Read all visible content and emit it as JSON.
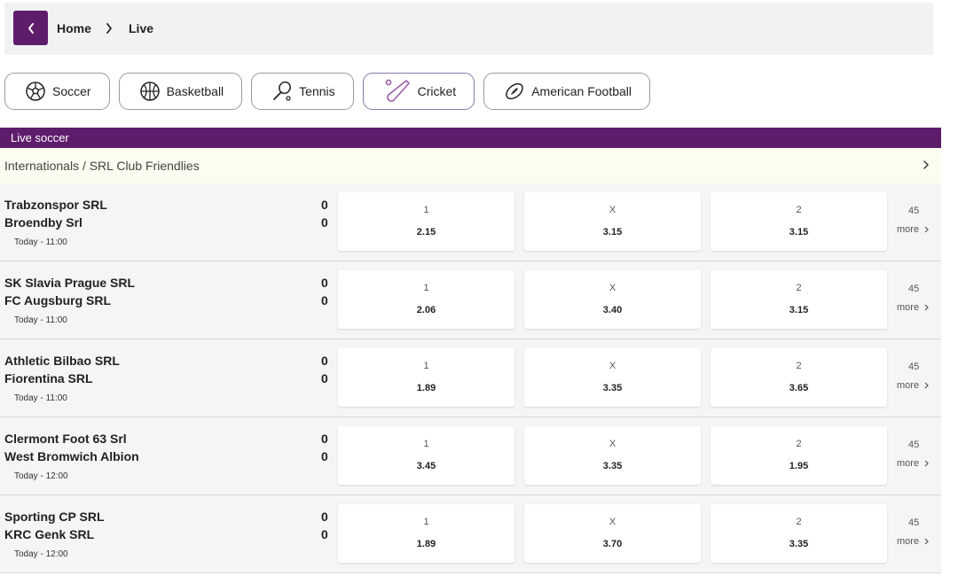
{
  "breadcrumb": {
    "home": "Home",
    "current": "Live"
  },
  "sports": [
    {
      "label": "Soccer",
      "icon": "soccer-ball-icon"
    },
    {
      "label": "Basketball",
      "icon": "basketball-icon"
    },
    {
      "label": "Tennis",
      "icon": "tennis-racket-icon"
    },
    {
      "label": "Cricket",
      "icon": "cricket-bat-icon"
    },
    {
      "label": "American Football",
      "icon": "american-football-icon"
    }
  ],
  "section_title": "Live soccer",
  "league": "Internationals / SRL Club Friendlies",
  "outcome_labels": {
    "home": "1",
    "draw": "X",
    "away": "2"
  },
  "more_label": "more",
  "matches": [
    {
      "home": "Trabzonspor SRL",
      "away": "Broendby Srl",
      "home_score": "0",
      "away_score": "0",
      "time": "Today - 11:00",
      "odd1": "2.15",
      "oddx": "3.15",
      "odd2": "3.15",
      "more_count": "45"
    },
    {
      "home": "SK Slavia Prague SRL",
      "away": "FC Augsburg SRL",
      "home_score": "0",
      "away_score": "0",
      "time": "Today - 11:00",
      "odd1": "2.06",
      "oddx": "3.40",
      "odd2": "3.15",
      "more_count": "45"
    },
    {
      "home": "Athletic Bilbao SRL",
      "away": "Fiorentina SRL",
      "home_score": "0",
      "away_score": "0",
      "time": "Today - 11:00",
      "odd1": "1.89",
      "oddx": "3.35",
      "odd2": "3.65",
      "more_count": "45"
    },
    {
      "home": "Clermont Foot 63 Srl",
      "away": "West Bromwich Albion",
      "home_score": "0",
      "away_score": "0",
      "time": "Today - 12:00",
      "odd1": "3.45",
      "oddx": "3.35",
      "odd2": "1.95",
      "more_count": "45"
    },
    {
      "home": "Sporting CP SRL",
      "away": "KRC Genk SRL",
      "home_score": "0",
      "away_score": "0",
      "time": "Today - 12:00",
      "odd1": "1.89",
      "oddx": "3.70",
      "odd2": "3.35",
      "more_count": "45"
    }
  ],
  "colors": {
    "brand": "#5e1d6b",
    "league_bg": "#fdfcf0",
    "row_bg": "#f5f5f5"
  }
}
